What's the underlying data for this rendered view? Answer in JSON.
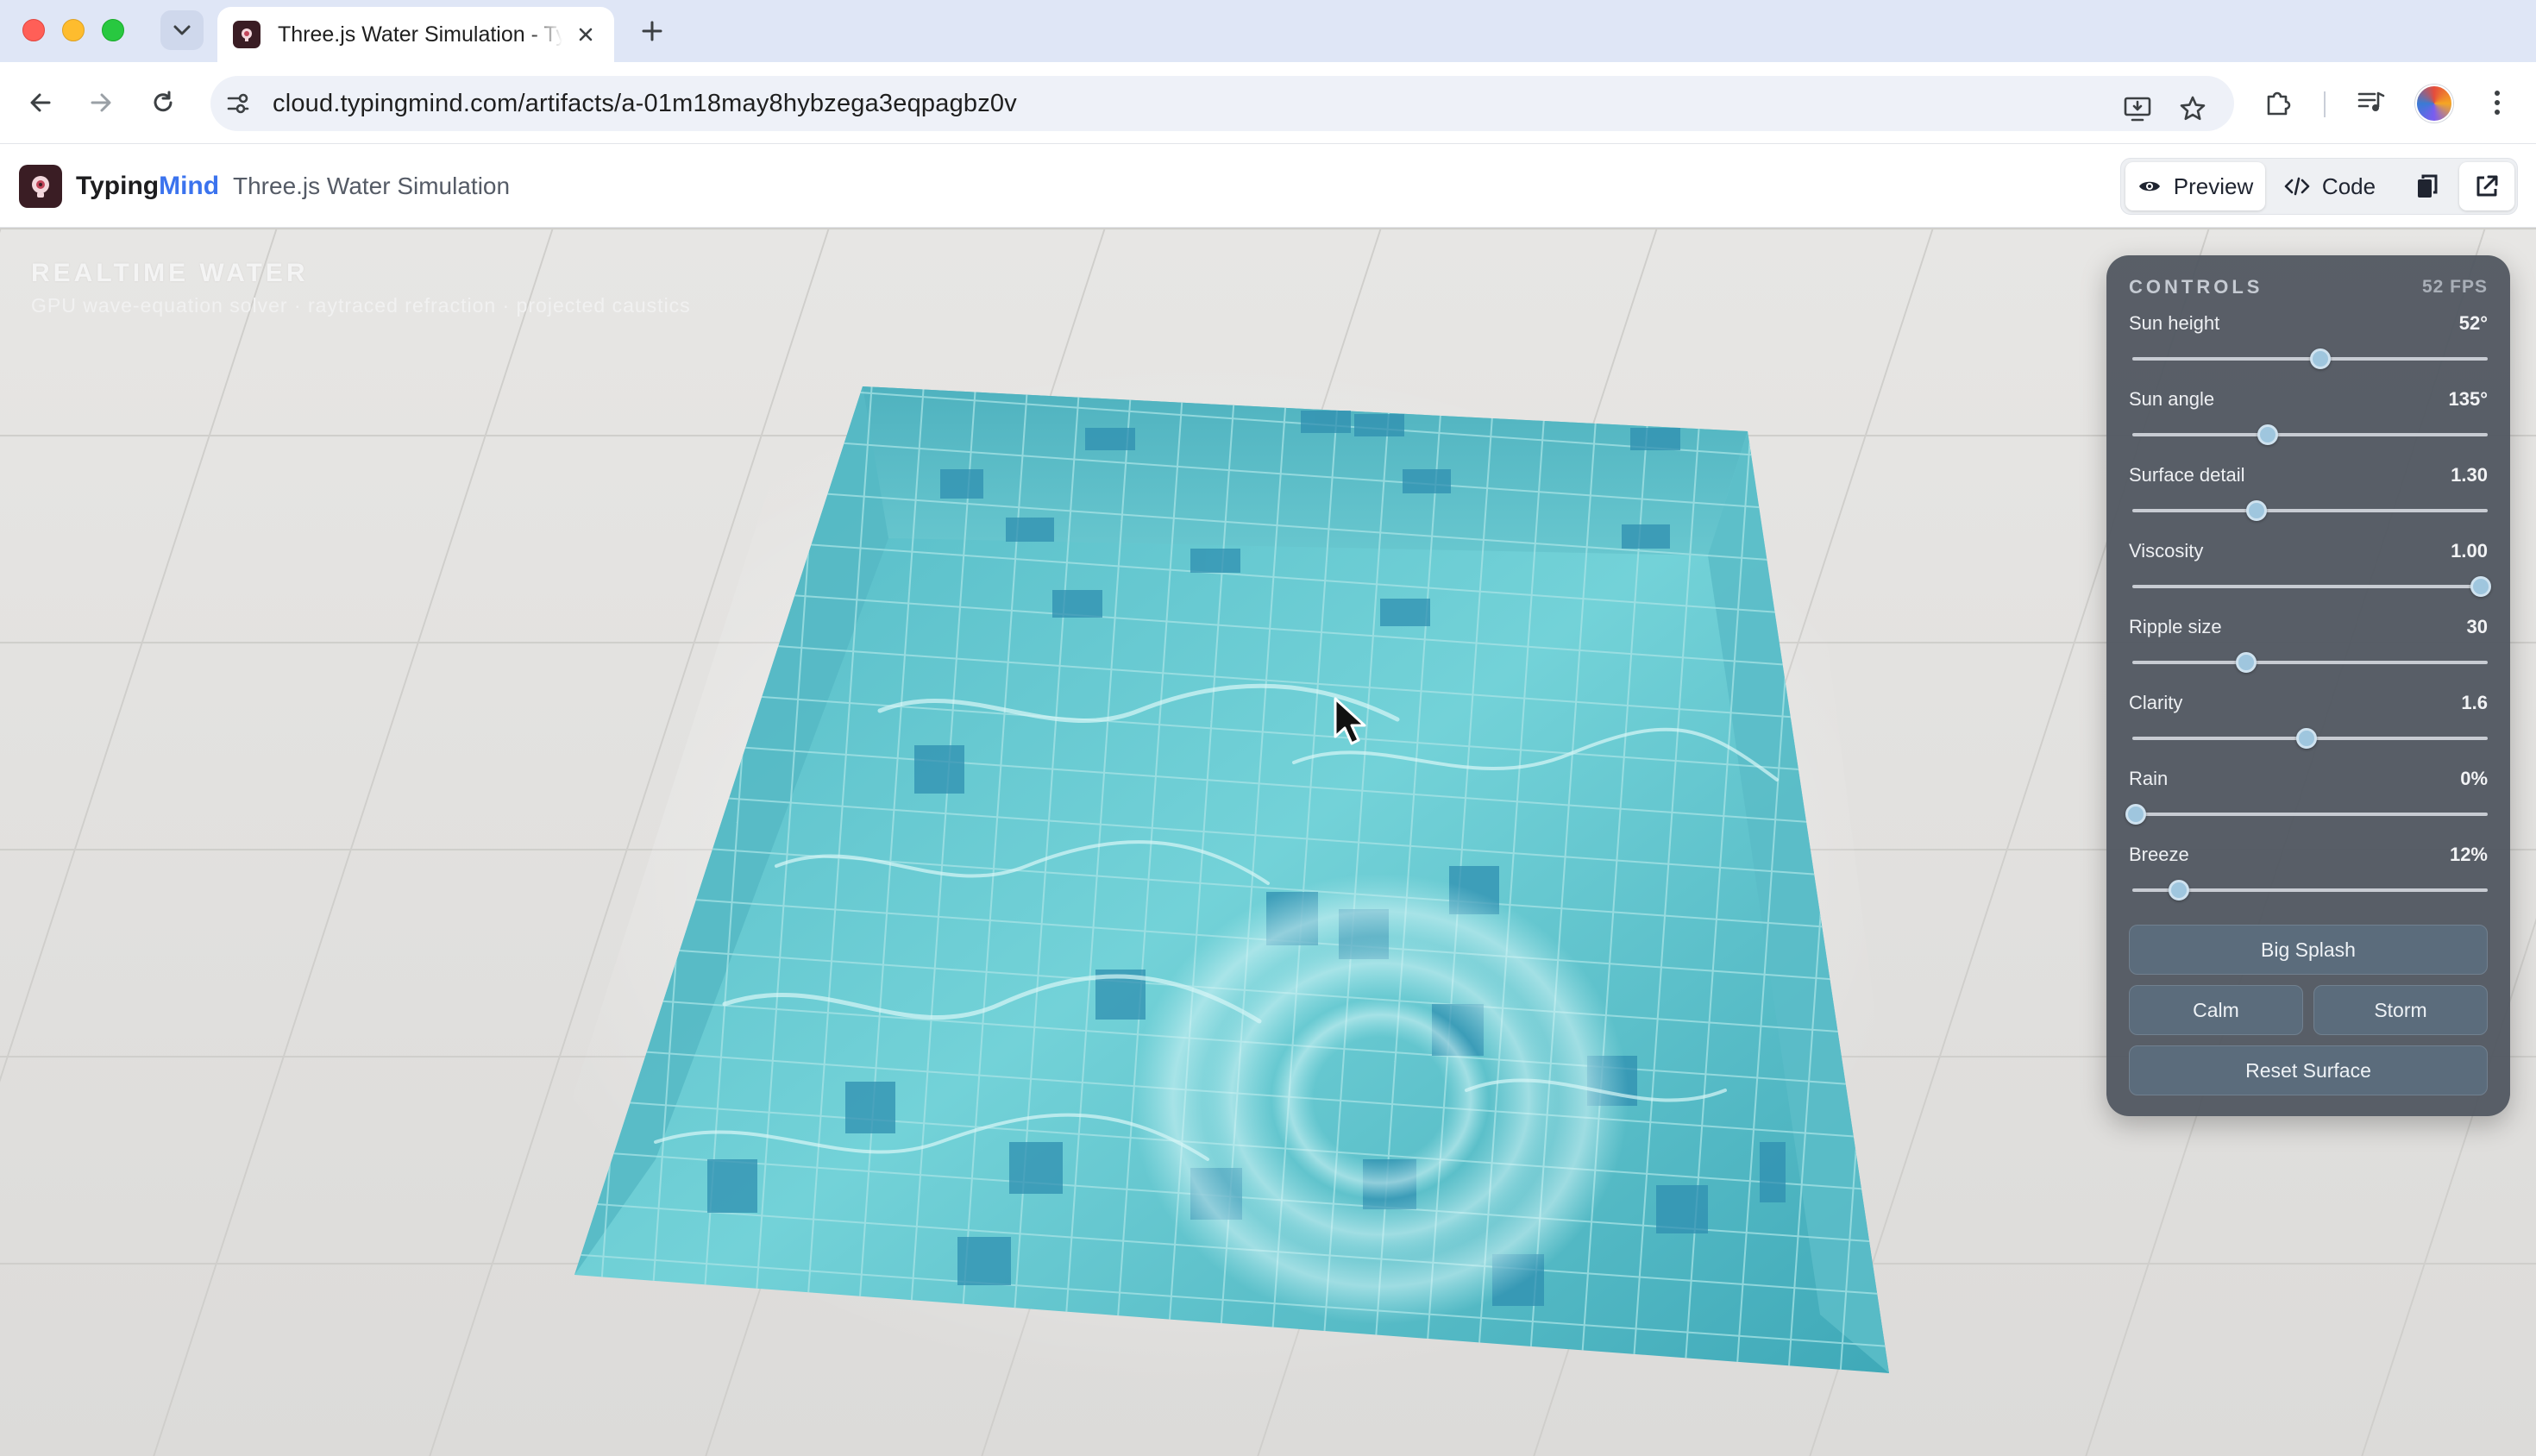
{
  "browser": {
    "tab_title": "Three.js Water Simulation - TypingMind",
    "url": "cloud.typingmind.com/artifacts/a-01m18may8hybzega3eqpagbz0v"
  },
  "app": {
    "brand_part1": "Typing",
    "brand_part2": "Mind",
    "artifact_title": "Three.js Water Simulation",
    "preview_label": "Preview",
    "code_label": "Code"
  },
  "scene": {
    "title": "REALTIME WATER",
    "subtitle": "GPU wave-equation solver · raytraced refraction · projected caustics"
  },
  "controls": {
    "header": "CONTROLS",
    "fps": "52 FPS",
    "sliders": [
      {
        "label": "Sun height",
        "value": "52°",
        "level": 0.53
      },
      {
        "label": "Sun angle",
        "value": "135°",
        "level": 0.38
      },
      {
        "label": "Surface detail",
        "value": "1.30",
        "level": 0.35
      },
      {
        "label": "Viscosity",
        "value": "1.00",
        "level": 0.98
      },
      {
        "label": "Ripple size",
        "value": "30",
        "level": 0.32
      },
      {
        "label": "Clarity",
        "value": "1.6",
        "level": 0.49
      },
      {
        "label": "Rain",
        "value": "0%",
        "level": 0.01
      },
      {
        "label": "Breeze",
        "value": "12%",
        "level": 0.13
      }
    ],
    "big_splash": "Big Splash",
    "calm": "Calm",
    "storm": "Storm",
    "reset": "Reset Surface"
  },
  "colors": {
    "accent": "#3b73ee",
    "water": "#5cc6cf",
    "panel": "#4e545e"
  }
}
